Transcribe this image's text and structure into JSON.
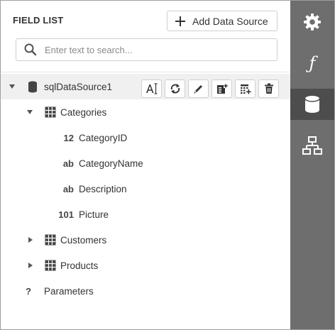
{
  "header": {
    "title": "FIELD LIST",
    "add_data_source_label": "Add Data Source"
  },
  "search": {
    "placeholder": "Enter text to search..."
  },
  "tree": {
    "datasource": {
      "label": "sqlDataSource1",
      "expanded": true
    },
    "categories": {
      "label": "Categories",
      "expanded": true
    },
    "fields": [
      {
        "type": "12",
        "label": "CategoryID"
      },
      {
        "type": "ab",
        "label": "CategoryName"
      },
      {
        "type": "ab",
        "label": "Description"
      },
      {
        "type": "101",
        "label": "Picture"
      }
    ],
    "customers": {
      "label": "Customers",
      "expanded": false
    },
    "products": {
      "label": "Products",
      "expanded": false
    },
    "parameters": {
      "type": "?",
      "label": "Parameters"
    }
  },
  "toolbar_icons": [
    "rename-icon",
    "refresh-icon",
    "edit-icon",
    "add-query-icon",
    "add-calculated-field-icon",
    "delete-icon"
  ],
  "tabs": [
    "gear-icon",
    "function-icon",
    "database-icon",
    "hierarchy-icon"
  ],
  "tab_function_glyph": "ƒ",
  "colors": {
    "tabbar_bg": "#6e6e6e",
    "tab_active_bg": "#4d4d4d",
    "selected_row_bg": "#f0f0f0",
    "border": "#cfcfcf",
    "text": "#333333"
  }
}
